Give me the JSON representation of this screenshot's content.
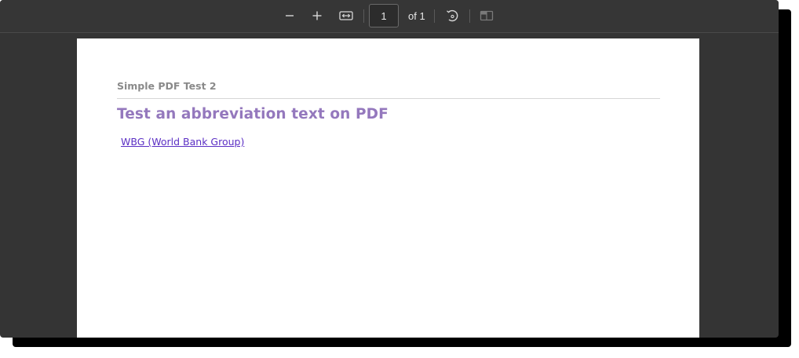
{
  "toolbar": {
    "buttons": [
      {
        "name": "zoom-out-button",
        "icon": "minus-icon"
      },
      {
        "name": "zoom-in-button",
        "icon": "plus-icon"
      },
      {
        "name": "fit-width-button",
        "icon": "fit-width-icon"
      },
      {
        "name": "rotate-button",
        "icon": "rotate-icon"
      },
      {
        "name": "two-page-view-button",
        "icon": "two-page-icon"
      }
    ],
    "page_number": "1",
    "page_of": "of 1"
  },
  "document": {
    "header": "Simple PDF Test 2",
    "title": "Test an abbreviation text on PDF",
    "link_text": "WBG (World Bank Group)"
  },
  "colors": {
    "viewer_background": "#343434",
    "title_color": "#9478bd",
    "link_color": "#5b2fc4",
    "header_color": "#8a8a8a"
  }
}
